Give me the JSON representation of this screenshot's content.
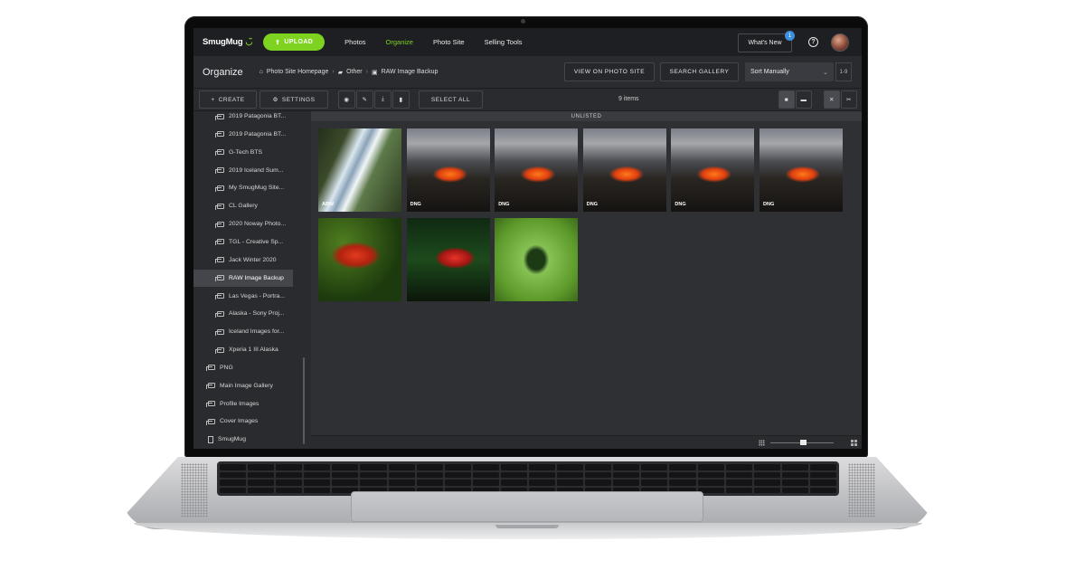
{
  "app": {
    "logo": "SmugMug",
    "upload_label": "UPLOAD",
    "nav": [
      "Photos",
      "Organize",
      "Photo Site",
      "Selling Tools"
    ],
    "active_nav": "Organize",
    "whats_new_label": "What's New",
    "whats_new_count": "1",
    "help_label": "?"
  },
  "header": {
    "title": "Organize",
    "breadcrumb": [
      "Photo Site Homepage",
      "Other",
      "RAW Image Backup"
    ],
    "view_on_photo_site": "VIEW ON PHOTO SITE",
    "search_gallery": "SEARCH GALLERY",
    "sort": "Sort Manually",
    "range": "1-9"
  },
  "toolbar": {
    "create": "CREATE",
    "settings": "SETTINGS",
    "select_all": "SELECT ALL",
    "count": "9 items"
  },
  "sidebar": {
    "items": [
      "2019 Patagonia BT...",
      "2019 Patagonia BT...",
      "G-Tech BTS",
      "2019 Iceland Sum...",
      "My SmugMug Site...",
      "CL Gallery",
      "2020 Noway Photo...",
      "TGL - Creative Sp...",
      "Jack Winter 2020",
      "RAW Image Backup",
      "Las Vegas - Portra...",
      "Alaska - Sony Proj...",
      "Iceland Images for...",
      "Xperia 1 III Alaska"
    ],
    "selected": "RAW Image Backup",
    "root_items": [
      "PNG",
      "Main Image Gallery",
      "Profile Images",
      "Cover Images",
      "SmugMug"
    ]
  },
  "gallery": {
    "section_label": "UNLISTED",
    "photos": [
      {
        "format": "ARW",
        "subject": "waterfall"
      },
      {
        "format": "DNG",
        "subject": "volcano"
      },
      {
        "format": "DNG",
        "subject": "volcano"
      },
      {
        "format": "DNG",
        "subject": "volcano"
      },
      {
        "format": "DNG",
        "subject": "volcano"
      },
      {
        "format": "DNG",
        "subject": "volcano"
      },
      {
        "format": "",
        "subject": "parrot"
      },
      {
        "format": "",
        "subject": "frog"
      },
      {
        "format": "",
        "subject": "bird"
      }
    ]
  },
  "colors": {
    "accent": "#7ed321",
    "background": "#26272b",
    "badge": "#3d8fe0"
  }
}
